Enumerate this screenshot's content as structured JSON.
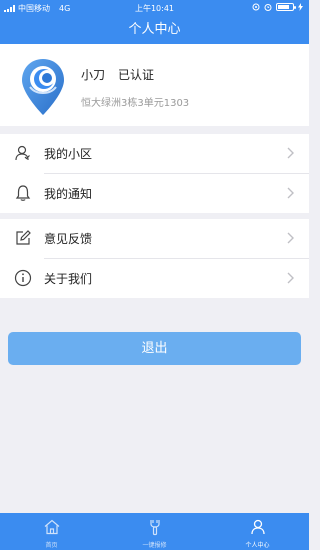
{
  "status_bar": {
    "carrier": "中国移动",
    "network": "4G",
    "time": "上午10:41",
    "battery_level": 0.75
  },
  "nav": {
    "title": "个人中心"
  },
  "profile": {
    "name": "小刀",
    "verified": "已认证",
    "address": "恒大绿洲3栋3单元1303"
  },
  "menu": {
    "group1": [
      {
        "label": "我的小区",
        "icon": "user-icon"
      },
      {
        "label": "我的通知",
        "icon": "bell-icon"
      }
    ],
    "group2": [
      {
        "label": "意见反馈",
        "icon": "edit-icon"
      },
      {
        "label": "关于我们",
        "icon": "info-icon"
      }
    ]
  },
  "logout_label": "退出",
  "tabbar": {
    "items": [
      {
        "label": "首页",
        "icon": "home-icon",
        "active": false
      },
      {
        "label": "一键报修",
        "icon": "repair-icon",
        "active": false
      },
      {
        "label": "个人中心",
        "icon": "person-icon",
        "active": true
      }
    ]
  },
  "colors": {
    "primary": "#3b8cf0",
    "button": "#6aaef0",
    "background": "#efeff4"
  }
}
